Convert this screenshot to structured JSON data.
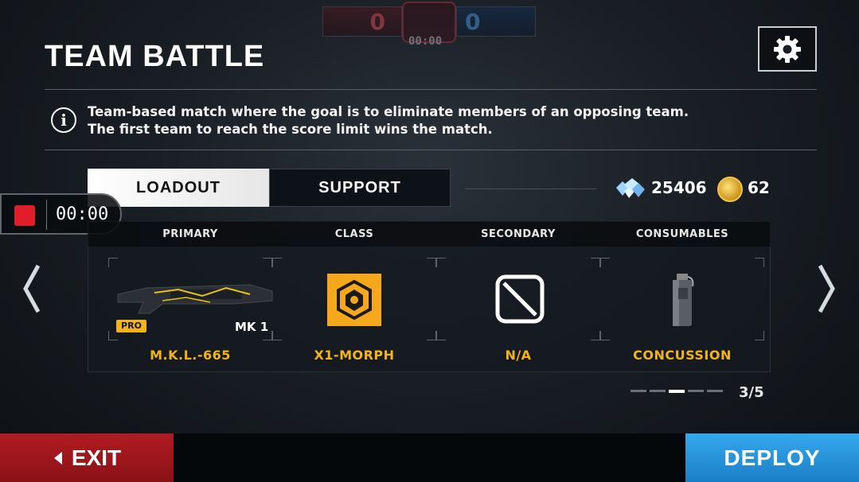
{
  "scoreboard": {
    "red_score": "0",
    "blue_score": "0",
    "timer": "00:00"
  },
  "header": {
    "title": "TEAM BATTLE"
  },
  "info": {
    "line1": "Team-based match where the goal is to eliminate members of an opposing team.",
    "line2": "The first team to reach the score limit wins the match."
  },
  "tabs": [
    {
      "label": "LOADOUT",
      "active": true
    },
    {
      "label": "SUPPORT",
      "active": false
    }
  ],
  "currency": {
    "gems": "25406",
    "coins": "62"
  },
  "recorder": {
    "time": "00:00"
  },
  "loadout": {
    "columns": [
      "PRIMARY",
      "CLASS",
      "SECONDARY",
      "CONSUMABLES"
    ],
    "items": [
      {
        "name": "M.K.L.-665",
        "badge": "PRO",
        "level": "MK 1"
      },
      {
        "name": "X1-MORPH"
      },
      {
        "name": "N/A"
      },
      {
        "name": "CONCUSSION"
      }
    ]
  },
  "pagination": {
    "label": "3/5",
    "current": 3,
    "total": 5
  },
  "buttons": {
    "exit": "EXIT",
    "deploy": "DEPLOY"
  },
  "colors": {
    "accent": "#f3b41b",
    "exit": "#a9181e",
    "deploy": "#2a96dd",
    "record": "#e01e2a"
  }
}
